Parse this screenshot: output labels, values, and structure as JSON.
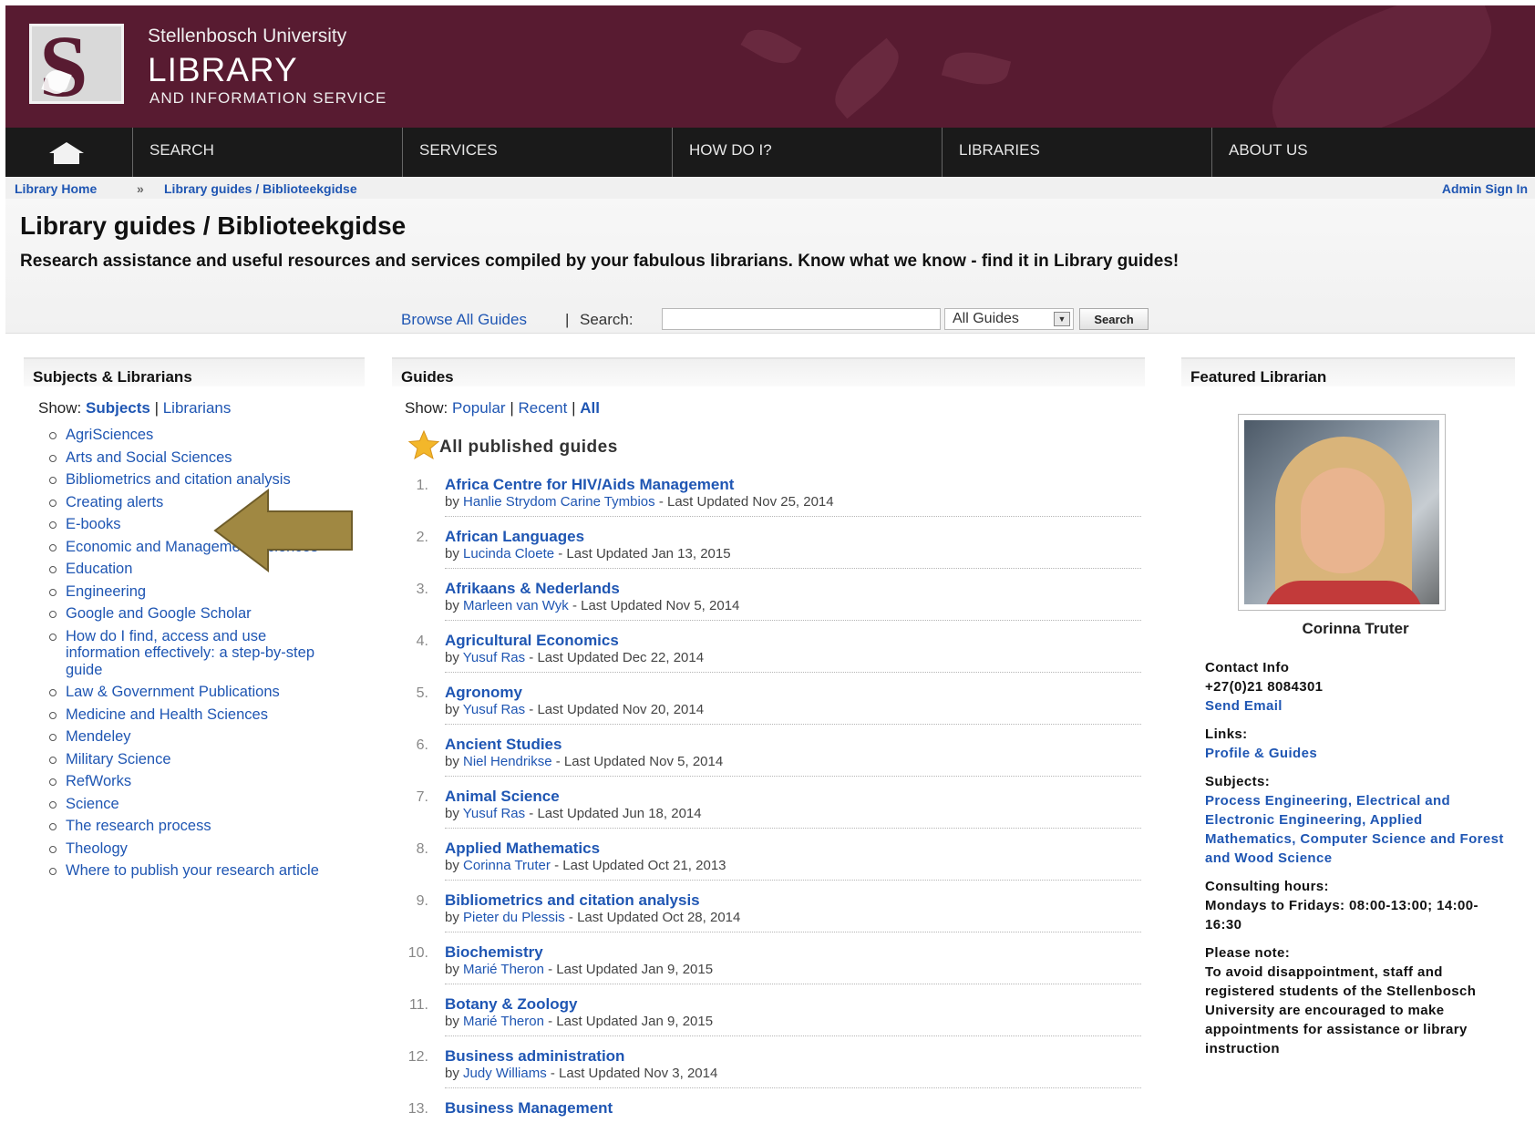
{
  "header": {
    "university": "Stellenbosch University",
    "library": "LIBRARY",
    "service": "AND INFORMATION SERVICE",
    "logo_letter": "S"
  },
  "nav": {
    "items": [
      {
        "label": "SEARCH"
      },
      {
        "label": "SERVICES"
      },
      {
        "label": "HOW DO I?"
      },
      {
        "label": "LIBRARIES"
      },
      {
        "label": "ABOUT US"
      }
    ]
  },
  "breadcrumb": {
    "home": "Library Home",
    "separator": "»",
    "current": "Library guides / Biblioteekgidse",
    "admin": "Admin Sign In"
  },
  "page": {
    "title": "Library guides / Biblioteekgidse",
    "description": "Research assistance and useful resources and services compiled by your fabulous librarians. Know what we know - find it in Library guides!"
  },
  "search": {
    "browse_label": "Browse All Guides",
    "search_label": "Search:",
    "input_value": "",
    "scope_selected": "All Guides",
    "button_label": "Search"
  },
  "subjects": {
    "heading": "Subjects & Librarians",
    "show_label": "Show:",
    "show_subjects": "Subjects",
    "show_librarians": "Librarians",
    "items": [
      {
        "label": "AgriSciences"
      },
      {
        "label": "Arts and Social Sciences"
      },
      {
        "label": "Bibliometrics and citation analysis"
      },
      {
        "label": "Creating alerts"
      },
      {
        "label": "E-books"
      },
      {
        "label": "Economic and Management Sciences"
      },
      {
        "label": "Education"
      },
      {
        "label": "Engineering"
      },
      {
        "label": "Google and Google Scholar"
      },
      {
        "label": "How do I find, access and use information effectively: a step-by-step guide"
      },
      {
        "label": "Law & Government Publications"
      },
      {
        "label": "Medicine and Health Sciences"
      },
      {
        "label": "Mendeley"
      },
      {
        "label": "Military Science"
      },
      {
        "label": "RefWorks"
      },
      {
        "label": "Science"
      },
      {
        "label": "The research process"
      },
      {
        "label": "Theology"
      },
      {
        "label": "Where to publish your research article"
      }
    ]
  },
  "guides": {
    "heading": "Guides",
    "show_label": "Show:",
    "show_popular": "Popular",
    "show_recent": "Recent",
    "show_all": "All",
    "list_heading": "All published guides",
    "items": [
      {
        "num": "1.",
        "title": "Africa Centre for HIV/Aids Management",
        "by": "by",
        "author": "Hanlie Strydom Carine Tymbios",
        "updated": "- Last Updated Nov 25, 2014"
      },
      {
        "num": "2.",
        "title": "African Languages",
        "by": "by",
        "author": "Lucinda Cloete",
        "updated": "- Last Updated Jan 13, 2015"
      },
      {
        "num": "3.",
        "title": "Afrikaans & Nederlands",
        "by": "by",
        "author": "Marleen van Wyk",
        "updated": "- Last Updated Nov 5, 2014"
      },
      {
        "num": "4.",
        "title": "Agricultural Economics",
        "by": "by",
        "author": "Yusuf Ras",
        "updated": "- Last Updated Dec 22, 2014"
      },
      {
        "num": "5.",
        "title": "Agronomy",
        "by": "by",
        "author": "Yusuf Ras",
        "updated": "- Last Updated Nov 20, 2014"
      },
      {
        "num": "6.",
        "title": "Ancient Studies",
        "by": "by",
        "author": "Niel Hendrikse",
        "updated": "- Last Updated Nov 5, 2014"
      },
      {
        "num": "7.",
        "title": "Animal Science",
        "by": "by",
        "author": "Yusuf Ras",
        "updated": "- Last Updated Jun 18, 2014"
      },
      {
        "num": "8.",
        "title": "Applied Mathematics",
        "by": "by",
        "author": "Corinna Truter",
        "updated": "- Last Updated Oct 21, 2013"
      },
      {
        "num": "9.",
        "title": "Bibliometrics and citation analysis",
        "by": "by",
        "author": "Pieter du Plessis",
        "updated": "- Last Updated Oct 28, 2014"
      },
      {
        "num": "10.",
        "title": "Biochemistry",
        "by": "by",
        "author": "Marié Theron",
        "updated": "- Last Updated Jan 9, 2015"
      },
      {
        "num": "11.",
        "title": "Botany & Zoology",
        "by": "by",
        "author": "Marié Theron",
        "updated": "- Last Updated Jan 9, 2015"
      },
      {
        "num": "12.",
        "title": "Business administration",
        "by": "by",
        "author": "Judy Williams",
        "updated": "- Last Updated Nov 3, 2014"
      },
      {
        "num": "13.",
        "title": "Business Management",
        "by": "",
        "author": "",
        "updated": ""
      }
    ]
  },
  "featured": {
    "heading": "Featured Librarian",
    "name": "Corinna Truter",
    "contact_label": "Contact Info",
    "phone": "+27(0)21 8084301",
    "email_link": "Send Email",
    "links_label": "Links:",
    "profile_link": "Profile & Guides",
    "subjects_label": "Subjects:",
    "subject_links": "Process Engineering, Electrical and Electronic Engineering, Applied Mathematics, Computer Science and Forest and Wood Science",
    "hours_label": "Consulting hours:",
    "hours": "Mondays to Fridays: 08:00-13:00; 14:00-16:30",
    "note_label": "Please note:",
    "note": "To avoid disappointment, staff and registered students of the Stellenbosch University are encouraged to make appointments for assistance or library instruction"
  },
  "colors": {
    "header_bg": "#581b31",
    "nav_bg": "#1a1a1a",
    "link": "#1f56b3",
    "arrow": "#a08842"
  },
  "icons": [
    "home-icon",
    "star-icon",
    "chevron-down-icon",
    "annotation-arrow"
  ]
}
